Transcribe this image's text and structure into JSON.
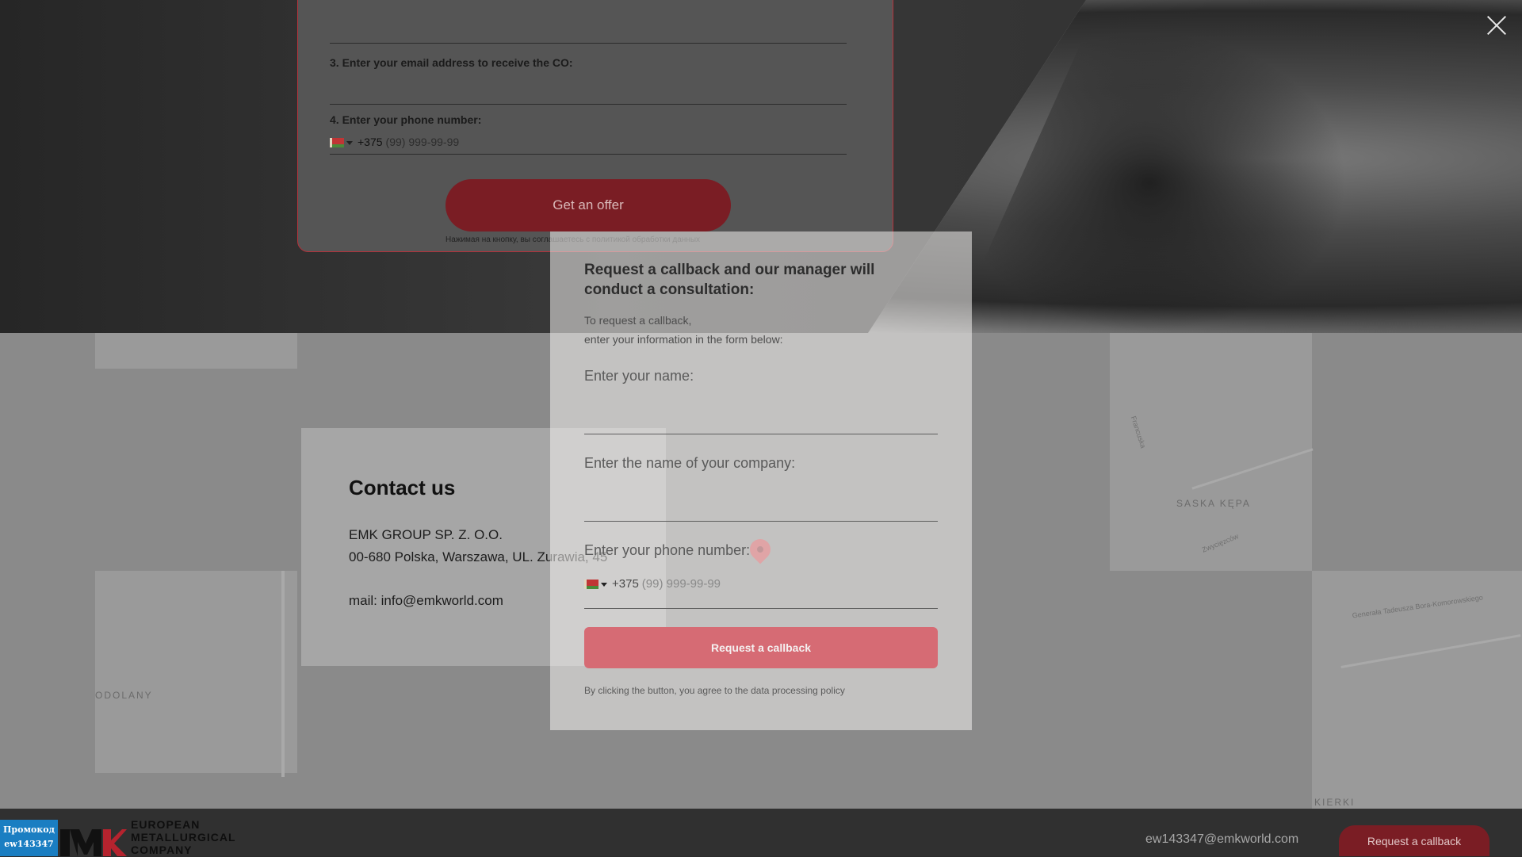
{
  "offer_form": {
    "email_label": "3. Enter your email address to receive the CO:",
    "phone_label": "4. Enter your phone number:",
    "phone_prefix": "+375",
    "phone_placeholder": "(99) 999-99-99",
    "submit_label": "Get an offer",
    "consent_note": "Нажимая на кнопку, вы соглашаетесь с политикой обработки данных"
  },
  "map": {
    "labels": [
      "SASKA KĘPA",
      "ODOLANY",
      "KIERKI"
    ],
    "streets": [
      "Generała Tadeusza Bora-Komorowskiego",
      "Francuska",
      "Zwycięzców"
    ]
  },
  "contact": {
    "title": "Contact us",
    "company": "EMK GROUP SP. Z. O.O.",
    "address": "00-680 Polska, Warszawa, UL. Zurawia, 45",
    "mail": "mail: info@emkworld.com"
  },
  "callback_modal": {
    "title": "Request a callback and our manager will conduct a consultation:",
    "subtitle_line1": "To request a callback,",
    "subtitle_line2": "enter your information in the form below:",
    "name_label": "Enter your name:",
    "company_label": "Enter the name of your company:",
    "phone_label": "Enter your phone number:",
    "phone_prefix": "+375",
    "phone_placeholder": "(99) 999-99-99",
    "submit_label": "Request a callback",
    "consent_note": "By clicking the button, you agree to the data processing policy"
  },
  "footer": {
    "promo_line1": "Промокод",
    "promo_line2": "ew143347",
    "logo_line1": "EUROPEAN",
    "logo_line2": "METALLURGICAL",
    "logo_line3": "COMPANY",
    "email": "ew143347@emkworld.com",
    "callback_label": "Request a callback"
  },
  "colors": {
    "brand_red": "#7a1d24",
    "promo_blue": "#1a7ec2"
  }
}
